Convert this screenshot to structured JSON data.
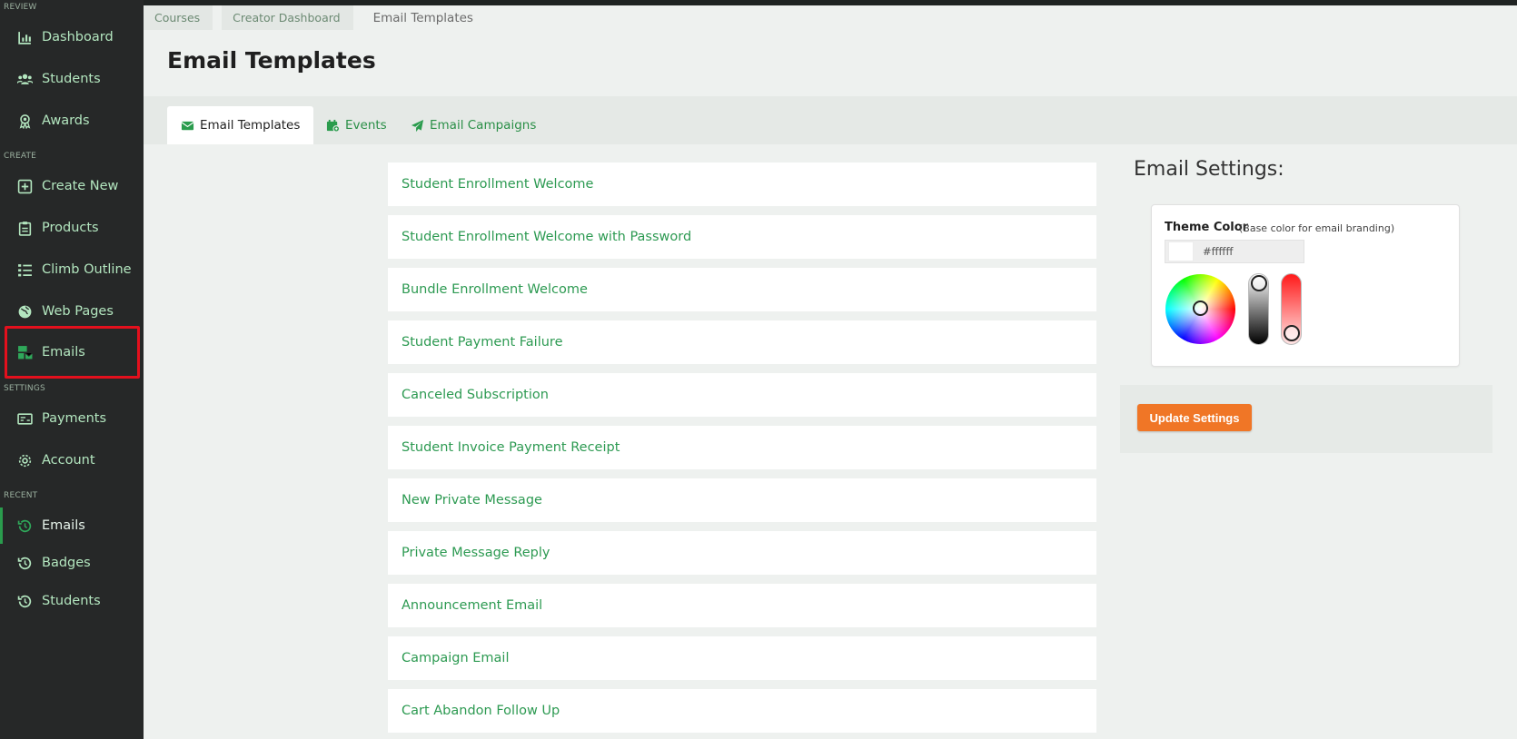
{
  "sidebar": {
    "sections": {
      "review": "REVIEW",
      "create": "CREATE",
      "settings": "SETTINGS",
      "recent": "RECENT"
    },
    "items": [
      {
        "label": "Dashboard",
        "icon": "chart-icon"
      },
      {
        "label": "Students",
        "icon": "users-icon"
      },
      {
        "label": "Awards",
        "icon": "award-icon"
      },
      {
        "label": "Create New",
        "icon": "plus-square-icon"
      },
      {
        "label": "Products",
        "icon": "clipboard-icon"
      },
      {
        "label": "Climb Outline",
        "icon": "list-icon"
      },
      {
        "label": "Web Pages",
        "icon": "globe-icon"
      },
      {
        "label": "Emails",
        "icon": "mail-bulk-icon"
      },
      {
        "label": "Payments",
        "icon": "money-check-icon"
      },
      {
        "label": "Account",
        "icon": "gear-icon"
      }
    ],
    "recent": [
      {
        "label": "Emails",
        "icon": "history-icon"
      },
      {
        "label": "Badges",
        "icon": "history-icon"
      },
      {
        "label": "Students",
        "icon": "history-icon"
      }
    ]
  },
  "breadcrumb": [
    "Courses",
    "Creator Dashboard",
    "Email Templates"
  ],
  "page": {
    "title": "Email Templates"
  },
  "tabs": [
    {
      "label": "Email Templates",
      "icon": "envelope-icon"
    },
    {
      "label": "Events",
      "icon": "calendar-icon"
    },
    {
      "label": "Email Campaigns",
      "icon": "paper-plane-icon"
    }
  ],
  "templates": [
    "Student Enrollment Welcome",
    "Student Enrollment Welcome with Password",
    "Bundle Enrollment Welcome",
    "Student Payment Failure",
    "Canceled Subscription",
    "Student Invoice Payment Receipt",
    "New Private Message",
    "Private Message Reply",
    "Announcement Email",
    "Campaign Email",
    "Cart Abandon Follow Up"
  ],
  "settings": {
    "title": "Email Settings:",
    "theme_label": "Theme Color",
    "theme_hint": "(Base color for email branding)",
    "color_value": "#ffffff",
    "update_label": "Update Settings"
  },
  "colors": {
    "sidebar_bg": "#262828",
    "accent_green": "#2d9a52",
    "button_orange": "#f07626",
    "highlight_red": "#e3101d"
  }
}
